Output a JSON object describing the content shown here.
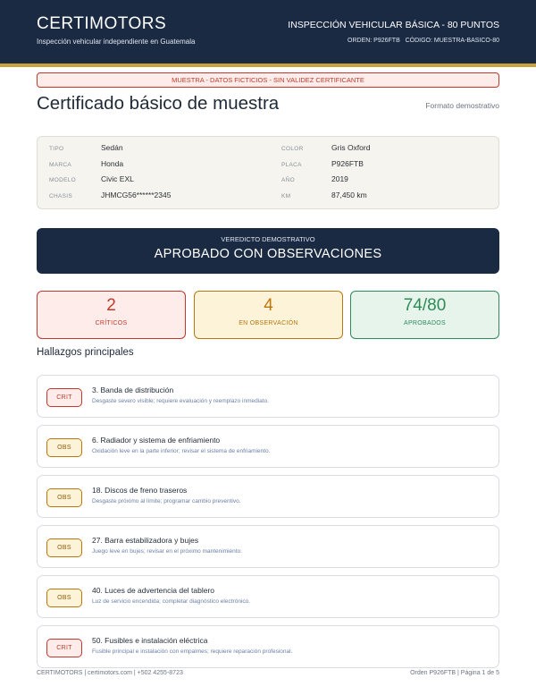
{
  "header": {
    "brand": "CERTIMOTORS",
    "tagline": "Inspección vehicular independiente en Guatemala",
    "doc_title": "INSPECCIÓN VEHICULAR BÁSICA - 80 PUNTOS",
    "doc_meta": "ORDEN: P926FTB   CÓDIGO: MUESTRA-BASICO-80"
  },
  "banner": "MUESTRA - DATOS FICTICIOS - SIN VALIDEZ CERTIFICANTE",
  "title": "Certificado básico de muestra",
  "subtitle": "Formato demostrativo",
  "vehicle": {
    "tipo_label": "TIPO",
    "tipo": "Sedán",
    "marca_label": "MARCA",
    "marca": "Honda",
    "modelo_label": "MODELO",
    "modelo": "Civic EXL",
    "chasis_label": "CHASIS",
    "chasis": "JHMCG56******2345",
    "color_label": "COLOR",
    "color": "Gris Oxford",
    "placa_label": "PLACA",
    "placa": "P926FTB",
    "anio_label": "AÑO",
    "anio": "2019",
    "km_label": "KM",
    "km": "87,450 km"
  },
  "verdict": {
    "label": "VEREDICTO DEMOSTRATIVO",
    "value": "APROBADO CON OBSERVACIONES"
  },
  "stats": {
    "criticos": {
      "value": "2",
      "label": "CRÍTICOS"
    },
    "observacion": {
      "value": "4",
      "label": "EN OBSERVACIÓN"
    },
    "aprobados": {
      "value": "74/80",
      "label": "APROBADOS"
    }
  },
  "findings_title": "Hallazgos principales",
  "findings": [
    {
      "badge": "CRIT",
      "title": "3. Banda de distribución",
      "desc": "Desgaste severo visible; requiere evaluación y reemplazo inmediato."
    },
    {
      "badge": "OBS",
      "title": "6. Radiador y sistema de enfriamiento",
      "desc": "Oxidación leve en la parte inferior; revisar el sistema de enfriamiento."
    },
    {
      "badge": "OBS",
      "title": "18. Discos de freno traseros",
      "desc": "Desgaste próximo al límite; programar cambio preventivo."
    },
    {
      "badge": "OBS",
      "title": "27. Barra estabilizadora y bujes",
      "desc": "Juego leve en bujes; revisar en el próximo mantenimiento."
    },
    {
      "badge": "OBS",
      "title": "40. Luces de advertencia del tablero",
      "desc": "Luz de servicio encendida; completar diagnóstico electrónico."
    },
    {
      "badge": "CRIT",
      "title": "50. Fusibles e instalación eléctrica",
      "desc": "Fusible principal e instalación con empalmes; requiere reparación profesional."
    }
  ],
  "footer": {
    "left": "CERTIMOTORS  |  certimotors.com  |  +502 4255-8723",
    "right": "Orden P926FTB  |  Página 1 de 5"
  },
  "colors": {
    "navy": "#1b2a43",
    "gold": "#c9a23c",
    "critical": "#c0392b",
    "observation": "#b9770e",
    "approved": "#2e8b57"
  }
}
